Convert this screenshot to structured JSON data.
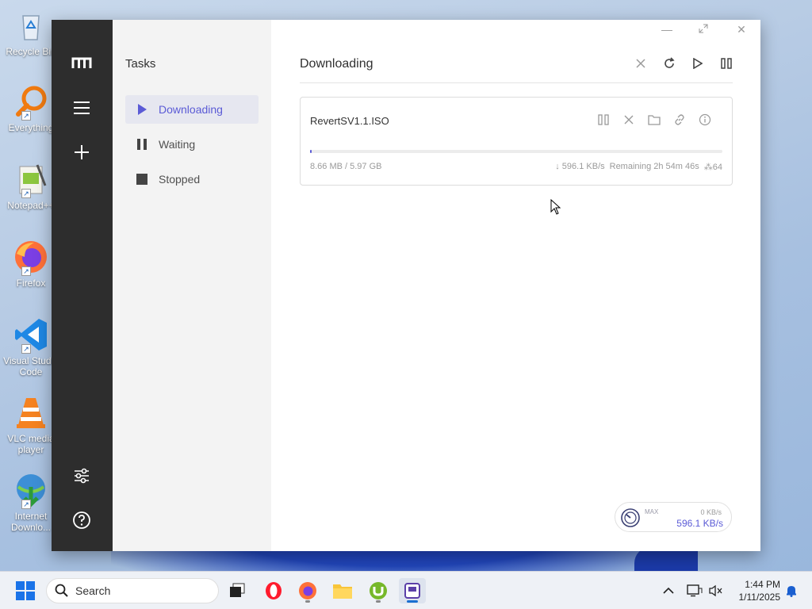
{
  "desktop": {
    "icons": [
      {
        "label": "Recycle Bin",
        "icon": "recycle-bin-icon"
      },
      {
        "label": "Everything",
        "icon": "everything-search-icon"
      },
      {
        "label": "Notepad++",
        "icon": "notepad-plus-plus-icon"
      },
      {
        "label": "Firefox",
        "icon": "firefox-icon"
      },
      {
        "label": "Visual Studio Code",
        "icon": "vscode-icon"
      },
      {
        "label": "VLC media player",
        "icon": "vlc-icon"
      },
      {
        "label": "Internet Downlo...",
        "icon": "internet-download-manager-icon"
      }
    ]
  },
  "app": {
    "rail": {
      "logo": "motrix-logo-icon",
      "items": [
        "menu-icon",
        "add-icon"
      ],
      "bottom": [
        "preferences-icon",
        "help-icon"
      ]
    },
    "tasks": {
      "title": "Tasks",
      "items": [
        {
          "label": "Downloading",
          "icon": "play-icon",
          "active": true
        },
        {
          "label": "Waiting",
          "icon": "pause-icon",
          "active": false
        },
        {
          "label": "Stopped",
          "icon": "stop-icon",
          "active": false
        }
      ]
    },
    "main": {
      "title": "Downloading",
      "toolbar": [
        "delete-icon",
        "refresh-icon",
        "resume-all-icon",
        "pause-all-icon"
      ],
      "task": {
        "name": "RevertSV1.1.ISO",
        "progress_fraction": 0.0014,
        "size": "8.66 MB / 5.97 GB",
        "speed": "↓ 596.1 KB/s",
        "remaining": "Remaining 2h 54m 46s",
        "connections": "64",
        "actions": [
          "pause-icon",
          "delete-icon",
          "folder-icon",
          "link-icon",
          "info-icon"
        ]
      }
    },
    "speedometer": {
      "max_label": "MAX",
      "limit": "0 KB/s",
      "current": "596.1 KB/s"
    },
    "accent_color": "#5b5bd6"
  },
  "taskbar": {
    "search_placeholder": "Search",
    "time": "1:44 PM",
    "date": "1/11/2025"
  }
}
